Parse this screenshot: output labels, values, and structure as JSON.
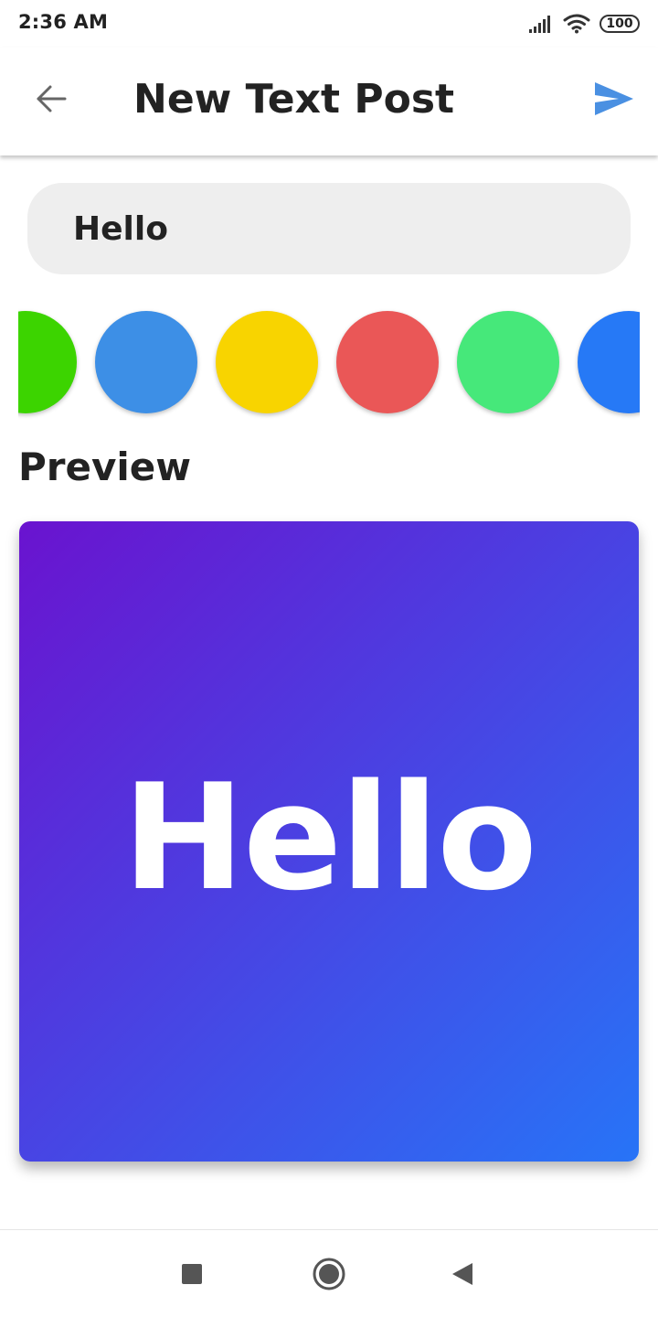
{
  "status_bar": {
    "time": "2:36 AM",
    "battery_level": "100",
    "icons": [
      "signal-icon",
      "wifi-icon",
      "battery-icon"
    ]
  },
  "app_bar": {
    "title": "New Text Post",
    "back_icon": "arrow-left-icon",
    "send_icon": "send-icon",
    "accent_color": "#4a90e2"
  },
  "text_input": {
    "value": "Hello",
    "background": "#eeeeee"
  },
  "color_swatches": [
    {
      "name": "green",
      "color": "#3cd400"
    },
    {
      "name": "blue",
      "color": "#3d8fe6"
    },
    {
      "name": "yellow",
      "color": "#f8d400"
    },
    {
      "name": "red",
      "color": "#ea5757"
    },
    {
      "name": "light-green",
      "color": "#46e87a"
    },
    {
      "name": "bright-blue",
      "color": "#2679f6"
    }
  ],
  "preview": {
    "label": "Preview",
    "text": "Hello",
    "gradient_start": "#6a13cf",
    "gradient_end": "#2774f7"
  },
  "nav_bar": {
    "icons": [
      "recents-square-icon",
      "home-circle-icon",
      "back-triangle-icon"
    ]
  }
}
